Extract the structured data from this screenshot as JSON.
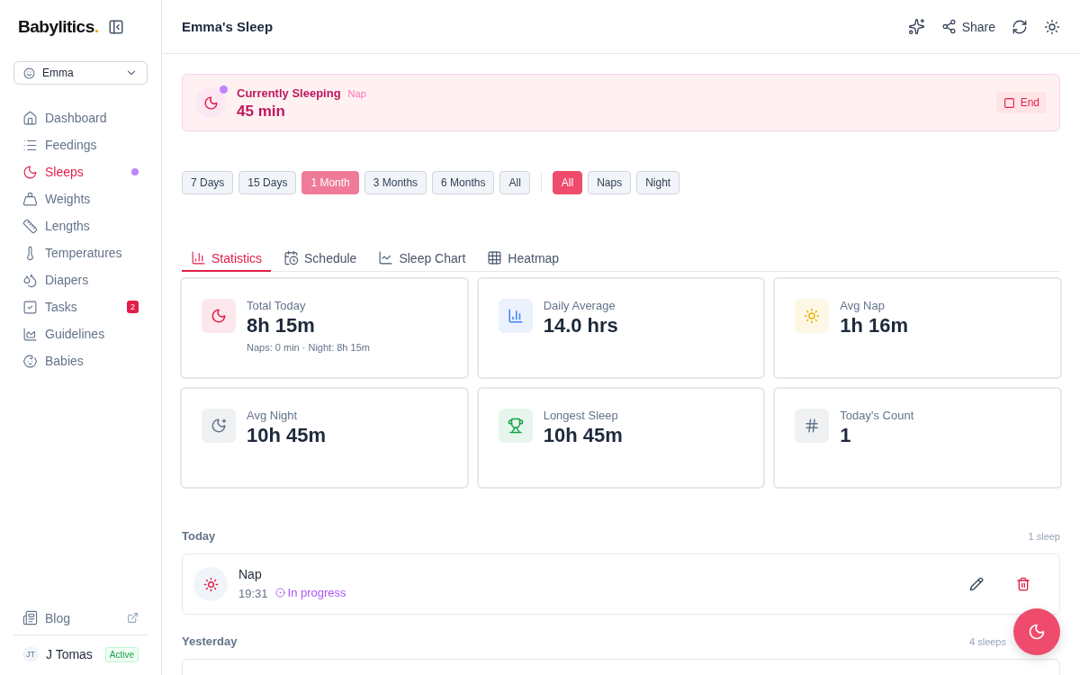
{
  "sidebar": {
    "logo": "Babylitics",
    "logo_dot": ".",
    "baby_select": {
      "value": "Emma"
    },
    "items": [
      {
        "label": "Dashboard",
        "selected": false
      },
      {
        "label": "Feedings",
        "selected": false
      },
      {
        "label": "Sleeps",
        "selected": true,
        "dot": true
      },
      {
        "label": "Weights",
        "selected": false
      },
      {
        "label": "Lengths",
        "selected": false
      },
      {
        "label": "Temperatures",
        "selected": false
      },
      {
        "label": "Diapers",
        "selected": false
      },
      {
        "label": "Tasks",
        "selected": false,
        "badge": "2"
      },
      {
        "label": "Guidelines",
        "selected": false
      },
      {
        "label": "Babies",
        "selected": false
      }
    ],
    "blog": {
      "label": "Blog"
    },
    "user": {
      "initials": "JT",
      "name": "J Tomas",
      "status": "Active"
    }
  },
  "header": {
    "title": "Emma's Sleep",
    "share": "Share"
  },
  "current": {
    "title": "Currently Sleeping",
    "type": "Nap",
    "duration": "45 min",
    "end": "End"
  },
  "ranges": [
    {
      "label": "7 Days",
      "selected": false
    },
    {
      "label": "15 Days",
      "selected": false
    },
    {
      "label": "1 Month",
      "selected": true
    },
    {
      "label": "3 Months",
      "selected": false
    },
    {
      "label": "6 Months",
      "selected": false
    },
    {
      "label": "All",
      "selected": false
    }
  ],
  "types": [
    {
      "label": "All",
      "selected": true
    },
    {
      "label": "Naps",
      "selected": false
    },
    {
      "label": "Night",
      "selected": false
    }
  ],
  "tabs": [
    {
      "label": "Statistics",
      "selected": true
    },
    {
      "label": "Schedule",
      "selected": false
    },
    {
      "label": "Sleep Chart",
      "selected": false
    },
    {
      "label": "Heatmap",
      "selected": false
    }
  ],
  "stats": [
    {
      "label": "Total Today",
      "value": "8h 15m",
      "note": "Naps: 0 min · Night: 8h 15m",
      "color": "#e11d48"
    },
    {
      "label": "Daily Average",
      "value": "14.0 hrs",
      "color": "#3b82f6"
    },
    {
      "label": "Avg Nap",
      "value": "1h 16m",
      "color": "#eab308"
    },
    {
      "label": "Avg Night",
      "value": "10h 45m",
      "color": "#64748b"
    },
    {
      "label": "Longest Sleep",
      "value": "10h 45m",
      "color": "#16a34a"
    },
    {
      "label": "Today's Count",
      "value": "1",
      "color": "#64748b"
    }
  ],
  "groups": [
    {
      "title": "Today",
      "count": "1 sleep",
      "entries": [
        {
          "title": "Nap",
          "time": "19:31",
          "status": "In progress"
        }
      ]
    },
    {
      "title": "Yesterday",
      "count": "4 sleeps"
    }
  ]
}
